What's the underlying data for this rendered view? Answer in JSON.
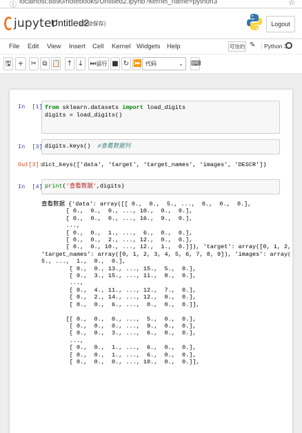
{
  "browser": {
    "url": "localhost:8890/notebooks/Untitled2.ipynb?kernel_name=python3",
    "info_icon": "info-circle-icon",
    "star_icon": "bookmark-star-icon"
  },
  "header": {
    "logo_text": "jupyter",
    "notebook_name": "Untitled2",
    "autosave_status": "(自动保存)",
    "logout_label": "Logout"
  },
  "menubar": {
    "items": [
      "File",
      "Edit",
      "View",
      "Insert",
      "Cell",
      "Kernel",
      "Widgets",
      "Help"
    ],
    "trusted_label": "可信的",
    "kernel_name": "Python 3"
  },
  "toolbar": {
    "run_label": "运行",
    "cell_type": "代码",
    "icons": [
      "save-icon",
      "add-cell-icon",
      "cut-icon",
      "copy-icon",
      "paste-icon",
      "move-up-icon",
      "move-down-icon",
      "run-icon",
      "stop-icon",
      "restart-icon",
      "restart-run-icon",
      "command-palette-icon"
    ]
  },
  "cells": [
    {
      "prompt": "In  [1]:",
      "code_lines": [
        [
          {
            "t": "kw",
            "v": "from"
          },
          {
            "t": "",
            "v": " sklearn.datasets "
          },
          {
            "t": "kw",
            "v": "import"
          },
          {
            "t": "",
            "v": " load_digits"
          }
        ],
        [
          {
            "t": "",
            "v": "digits "
          },
          {
            "t": "",
            "v": "="
          },
          {
            "t": "",
            "v": " load_digits()"
          }
        ]
      ]
    },
    {
      "prompt": "In  [3]:",
      "code_lines": [
        [
          {
            "t": "",
            "v": "digits.keys()  "
          },
          {
            "t": "cm",
            "v": "#查看数据列"
          }
        ]
      ],
      "out_prompt": "Out[3]:",
      "output": "dict_keys(['data', 'target', 'target_names', 'images', 'DESCR'])"
    },
    {
      "prompt": "In  [4]:",
      "code_lines": [
        [
          {
            "t": "bi",
            "v": "print"
          },
          {
            "t": "",
            "v": "("
          },
          {
            "t": "str",
            "v": "'查看数据'"
          },
          {
            "t": "",
            "v": ",digits)"
          }
        ]
      ],
      "output_lines": [
        "查看数据 {'data': array([[ 0.,  0.,  5., ...,  0.,  0.,  0.],",
        "       [ 0.,  0.,  0., ..., 10.,  0.,  0.],",
        "       [ 0.,  0.,  0., ..., 16.,  9.,  0.],",
        "       ...,",
        "       [ 0.,  0.,  1., ...,  6.,  0.,  0.],",
        "       [ 0.,  0.,  2., ..., 12.,  0.,  0.],",
        "       [ 0.,  0., 10., ..., 12.,  1.,  0.]]), 'target': array([0, 1, 2, ..., 8, 9, 8]),",
        "'target_names': array([0, 1, 2, 3, 4, 5, 6, 7, 8, 9]), 'images': array([[[ 0.,  0.,",
        "5., ...,  1.,  0.,  0.],",
        "        [ 0.,  0., 13., ..., 15.,  5.,  0.],",
        "        [ 0.,  3., 15., ..., 11.,  8.,  0.],",
        "        ...,",
        "        [ 0.,  4., 11., ..., 12.,  7.,  0.],",
        "        [ 0.,  2., 14., ..., 12.,  0.,  0.],",
        "        [ 0.,  0.,  6., ...,  0.,  0.,  0.]],",
        "",
        "       [[ 0.,  0.,  0., ...,  5.,  0.,  0.],",
        "        [ 0.,  0.,  0., ...,  9.,  0.,  0.],",
        "        [ 0.,  0.,  3., ...,  6.,  0.,  0.],",
        "        ...,",
        "        [ 0.,  0.,  1., ...,  6.,  0.,  0.],",
        "        [ 0.,  0.,  1., ...,  6.,  0.,  0.],",
        "        [ 0.,  0.,  0., ..., 10.,  0.,  0.]],"
      ]
    }
  ]
}
